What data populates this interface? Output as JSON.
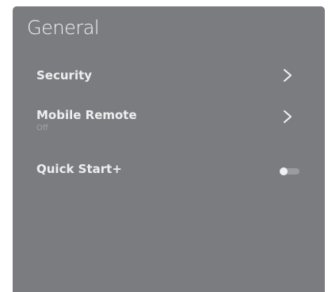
{
  "panel": {
    "title": "General"
  },
  "menu": {
    "items": [
      {
        "label": "Security",
        "sublabel": "",
        "control": "chevron-right-icon"
      },
      {
        "label": "Mobile Remote",
        "sublabel": "Off",
        "control": "chevron-right-icon"
      },
      {
        "label": "Quick Start+",
        "sublabel": "",
        "control": "toggle",
        "toggle_on": false
      }
    ]
  },
  "colors": {
    "panel_bg": "#7b7c80",
    "text": "#eeeeef",
    "subtext": "#a3a4a7"
  }
}
